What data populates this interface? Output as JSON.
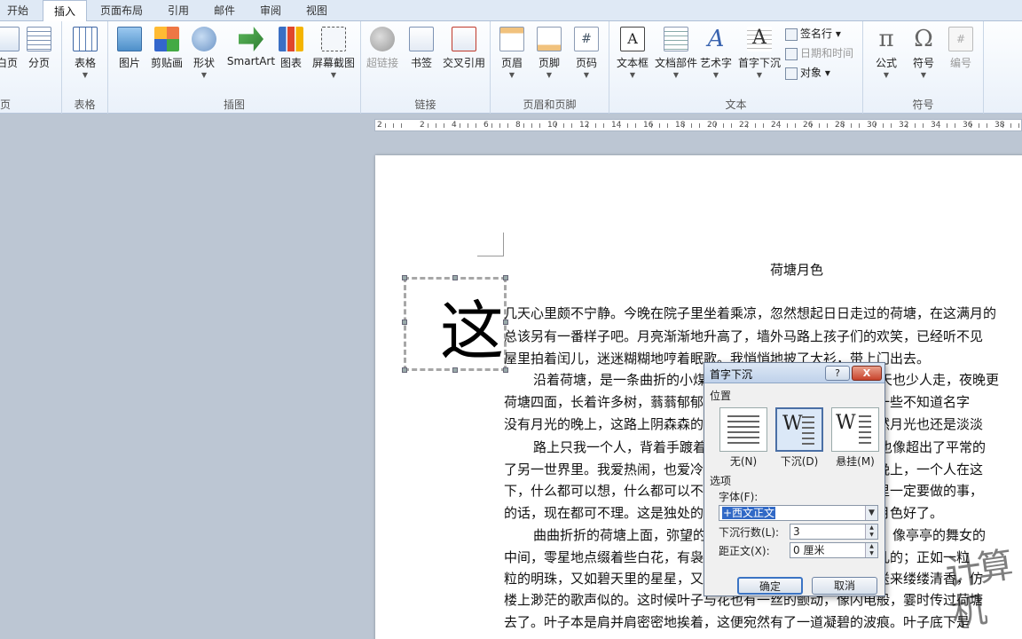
{
  "tabs": [
    "开始",
    "插入",
    "页面布局",
    "引用",
    "邮件",
    "审阅",
    "视图"
  ],
  "active_tab": "插入",
  "ribbon": {
    "pages": {
      "label": "页",
      "buttons": [
        "白页",
        "分页"
      ]
    },
    "table": {
      "label": "表格",
      "buttons": [
        "表格"
      ]
    },
    "illustrations": {
      "label": "插图",
      "buttons": [
        "图片",
        "剪贴画",
        "形状",
        "SmartArt",
        "图表",
        "屏幕截图"
      ]
    },
    "links": {
      "label": "链接",
      "buttons": [
        "超链接",
        "书签",
        "交叉引用"
      ]
    },
    "header_footer": {
      "label": "页眉和页脚",
      "buttons": [
        "页眉",
        "页脚",
        "页码"
      ]
    },
    "text": {
      "label": "文本",
      "buttons": [
        "文本框",
        "文档部件",
        "艺术字",
        "首字下沉"
      ],
      "small": [
        "签名行",
        "日期和时间",
        "对象"
      ]
    },
    "symbols": {
      "label": "符号",
      "buttons": [
        "公式",
        "符号",
        "编号"
      ]
    }
  },
  "ruler": {
    "numbers": [
      "2",
      "2",
      "4",
      "6",
      "8",
      "10",
      "12",
      "14",
      "16",
      "18",
      "20",
      "22",
      "24",
      "26",
      "28",
      "30",
      "32",
      "34",
      "36",
      "38"
    ]
  },
  "document": {
    "title": "荷塘月色",
    "dropcap_char": "这",
    "lines": [
      "几天心里颇不宁静。今晚在院子里坐着乘凉，忽然想起日日走过的荷塘，在这满月的",
      "总该另有一番样子吧。月亮渐渐地升高了，墙外马路上孩子们的欢笑，已经听不见",
      "屋里拍着闰儿，迷迷糊糊地哼着眠歌。我悄悄地披了大衫，带上门出去。",
      "沿着荷塘，是一条曲折的小煤屑路。这是一条幽僻的路；白天也少人走，夜晚更",
      "荷塘四面，长着许多树，蓊蓊郁郁的。路的一旁，是些杨柳，和一些不知道名字",
      "没有月光的晚上，这路上阴森森的，有些怕人。今晚却很好，虽然月光也还是淡淡",
      "路上只我一个人，背着手踱着。这一片天地好像是我的；我也像超出了平常的",
      "了另一世界里。我爱热闹，也爱冷静；爱群居，也爱独处。像今晚上，一个人在这",
      "下，什么都可以想，什么都可以不想，便觉是个自由的人。白天里一定要做的事，",
      "的话，现在都可不理。这是独处的妙处，我且受用这无边的荷香月色好了。",
      "曲曲折折的荷塘上面，弥望的是田田的叶子。叶子出水很高，像亭亭的舞女的",
      "中间，零星地点缀着些白花，有袅娜地开着的，有羞涩地打着朵儿的；正如一粒",
      "粒的明珠，又如碧天里的星星，又如刚出浴的美人。微风过处，送来缕缕清香，仿",
      "楼上渺茫的歌声似的。这时候叶子与花也有一丝的颤动，像闪电般，霎时传过荷塘",
      "去了。叶子本是肩并肩密密地挨着，这便宛然有了一道凝碧的波痕。叶子底下是"
    ]
  },
  "dialog": {
    "title": "首字下沉",
    "help": "?",
    "close": "X",
    "position_label": "位置",
    "options": [
      {
        "label": "无(N)"
      },
      {
        "label": "下沉(D)"
      },
      {
        "label": "悬挂(M)"
      }
    ],
    "selected_option": "下沉(D)",
    "options_label": "选项",
    "font_label": "字体(F):",
    "font_value": "+西文正文",
    "lines_label": "下沉行数(L):",
    "lines_value": "3",
    "distance_label": "距正文(X):",
    "distance_value": "0 厘米",
    "ok": "确定",
    "cancel": "取消"
  },
  "watermark": "计算机"
}
